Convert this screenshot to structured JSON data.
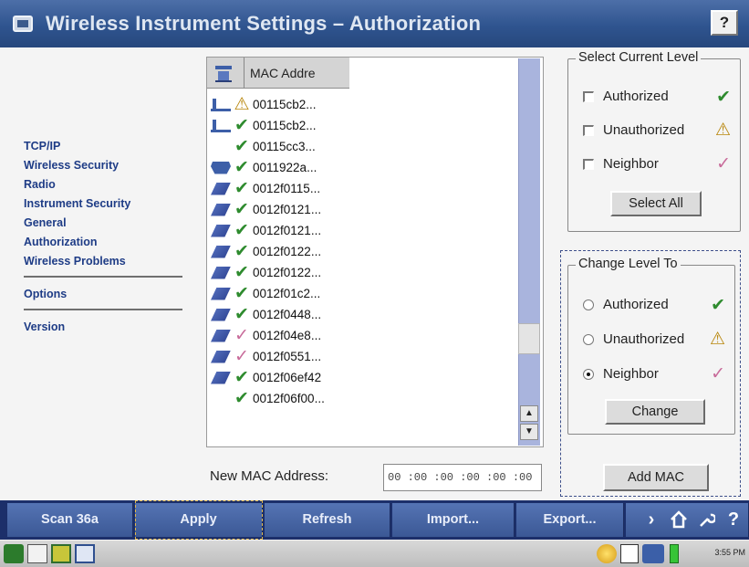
{
  "title": "Wireless Instrument Settings – Authorization",
  "help_label": "?",
  "nav": {
    "items": [
      "TCP/IP",
      "Wireless Security",
      "Radio",
      "Instrument Security",
      "General",
      "Authorization",
      "Wireless Problems"
    ],
    "extra": [
      "Options",
      "Version"
    ]
  },
  "list": {
    "header": "MAC Addre",
    "rows": [
      {
        "device": "radio",
        "status": "warning",
        "mac": "00115cb2..."
      },
      {
        "device": "radio",
        "status": "authorized",
        "mac": "00115cb2..."
      },
      {
        "device": "",
        "status": "authorized",
        "mac": "00115cc3..."
      },
      {
        "device": "bridge",
        "status": "authorized",
        "mac": "0011922a..."
      },
      {
        "device": "instrument",
        "status": "authorized",
        "mac": "0012f0115..."
      },
      {
        "device": "instrument",
        "status": "authorized",
        "mac": "0012f0121..."
      },
      {
        "device": "instrument",
        "status": "authorized",
        "mac": "0012f0121..."
      },
      {
        "device": "instrument",
        "status": "authorized",
        "mac": "0012f0122..."
      },
      {
        "device": "instrument",
        "status": "authorized",
        "mac": "0012f0122..."
      },
      {
        "device": "instrument",
        "status": "authorized",
        "mac": "0012f01c2..."
      },
      {
        "device": "instrument",
        "status": "authorized",
        "mac": "0012f0448..."
      },
      {
        "device": "instrument",
        "status": "neighbor",
        "mac": "0012f04e8..."
      },
      {
        "device": "instrument",
        "status": "neighbor",
        "mac": "0012f0551..."
      },
      {
        "device": "instrument",
        "status": "authorized",
        "mac": "0012f06ef42"
      },
      {
        "device": "",
        "status": "authorized",
        "mac": "0012f06f00..."
      }
    ]
  },
  "select_level": {
    "legend": "Select Current Level",
    "options": [
      "Authorized",
      "Unauthorized",
      "Neighbor"
    ],
    "button": "Select All"
  },
  "change_level": {
    "legend": "Change Level To",
    "options": [
      "Authorized",
      "Unauthorized",
      "Neighbor"
    ],
    "selected": "Neighbor",
    "button": "Change"
  },
  "new_mac": {
    "label": "New MAC Address:",
    "value": "00 :00 :00 :00 :00 :00",
    "button": "Add MAC"
  },
  "toolbar": [
    "Scan 36a",
    "Apply",
    "Refresh",
    "Import...",
    "Export..."
  ],
  "toolbar_icons": [
    "next-icon",
    "home-icon",
    "wrench-icon",
    "help-icon"
  ],
  "clock": "3:55 PM",
  "colors": {
    "title_bar": "#2f548f",
    "toolbar": "#3b5895",
    "authorized": "#2e8b2e",
    "neighbor": "#c86b9a",
    "warning": "#b8860b"
  }
}
